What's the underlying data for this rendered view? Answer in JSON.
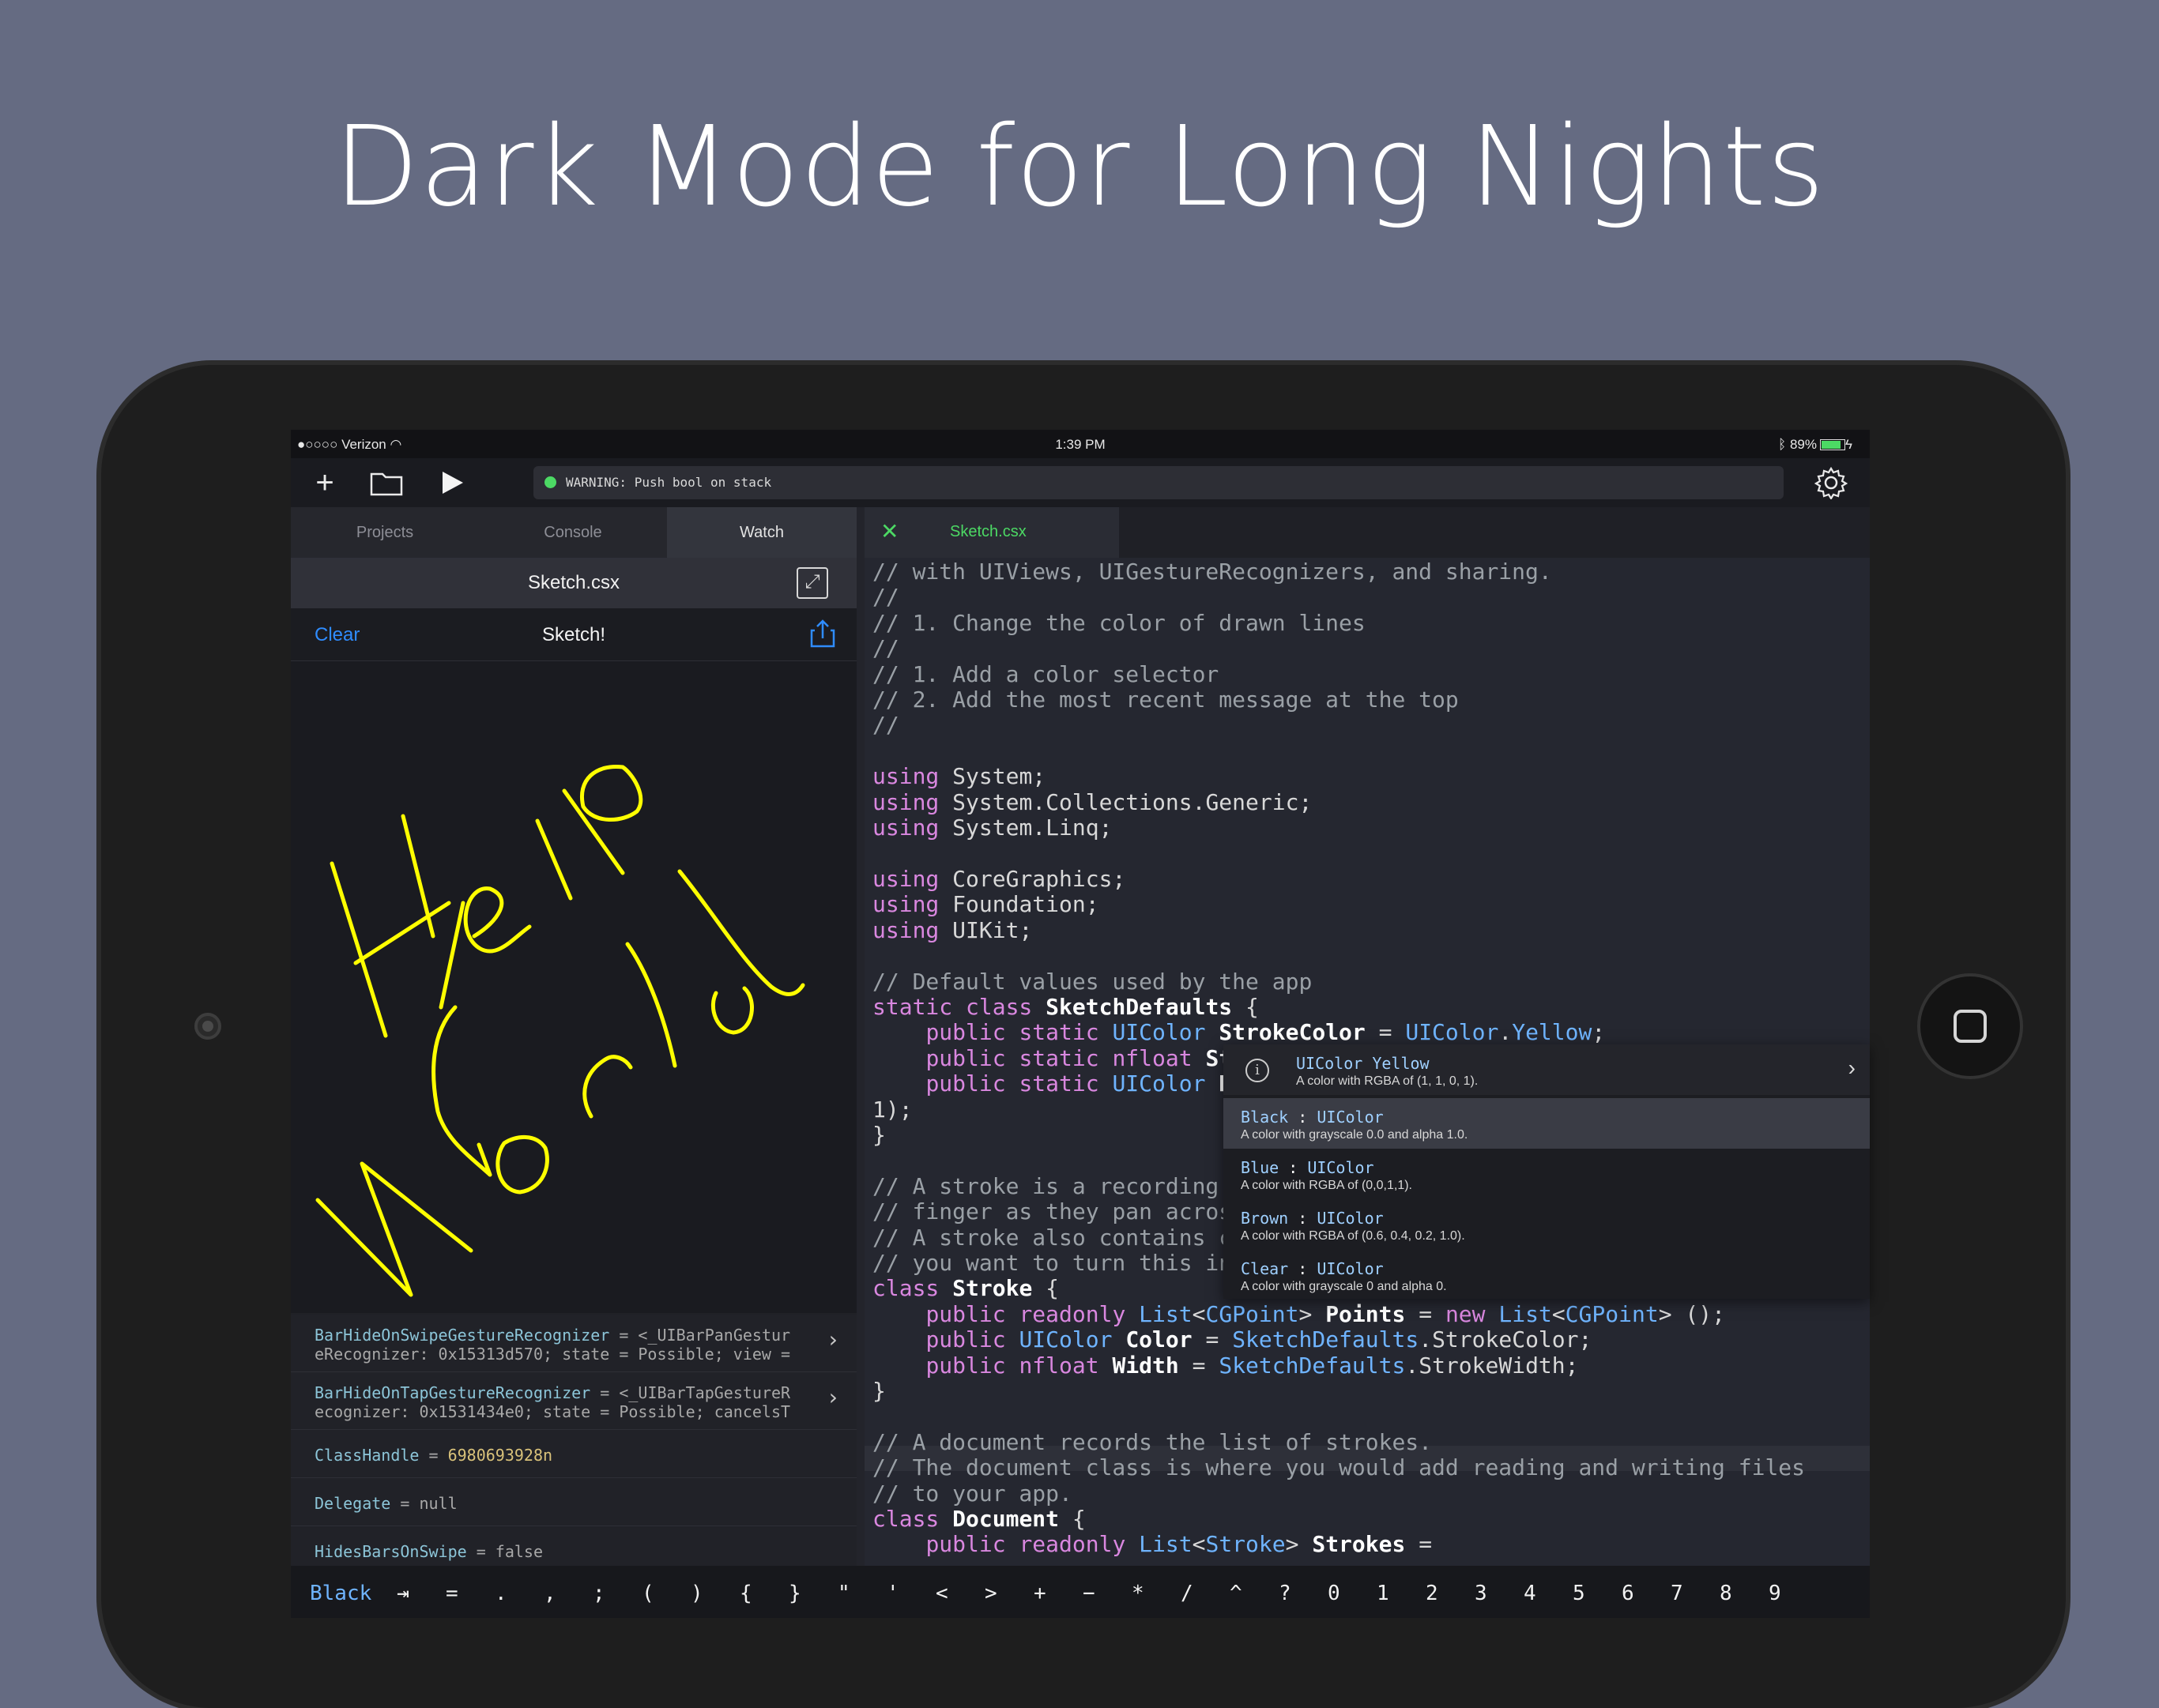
{
  "headline": "Dark Mode for Long Nights",
  "status": {
    "carrier": "●○○○○ Verizon",
    "time": "1:39 PM",
    "battery": "89%"
  },
  "toolbar": {
    "warning": "WARNING: Push bool on stack"
  },
  "left": {
    "tabs": [
      "Projects",
      "Console",
      "Watch"
    ],
    "file_title": "Sketch.csx",
    "clear_label": "Clear",
    "sketch_title": "Sketch!",
    "watch_rows": [
      {
        "name": "BarHideOnSwipeGestureRecognizer",
        "line1": " = <_UIBarPanGestur",
        "line2": "eRecognizer: 0x15313d570; state = Possible; view ="
      },
      {
        "name": "BarHideOnTapGestureRecognizer",
        "line1": " = <_UIBarTapGestureR",
        "line2": "ecognizer: 0x1531434e0; state = Possible; cancelsT"
      },
      {
        "name": "ClassHandle",
        "eq": " = ",
        "value": "6980693928n"
      },
      {
        "name": "Delegate",
        "eq": " = ",
        "value": "null"
      },
      {
        "name": "HidesBarsOnSwipe",
        "eq": " = ",
        "value": "false"
      }
    ]
  },
  "editor": {
    "tab_name": "Sketch.csx"
  },
  "autocomplete": {
    "info_title": "UIColor Yellow",
    "info_desc": "A color with RGBA of (1, 1, 0, 1).",
    "items": [
      {
        "name": "Black",
        "type": "UIColor",
        "desc": "A color with grayscale 0.0 and alpha 1.0."
      },
      {
        "name": "Blue",
        "type": "UIColor",
        "desc": "A color with RGBA of (0,0,1,1)."
      },
      {
        "name": "Brown",
        "type": "UIColor",
        "desc": "A color with RGBA of (0.6, 0.4, 0.2, 1.0)."
      },
      {
        "name": "Clear",
        "type": "UIColor",
        "desc": "A color with grayscale 0 and alpha 0."
      }
    ]
  },
  "keys": [
    "Black",
    "⇥",
    "=",
    ".",
    ",",
    ";",
    "(",
    ")",
    "{",
    "}",
    "\"",
    "'",
    "<",
    ">",
    "+",
    "−",
    "*",
    "/",
    "^",
    "?",
    "0",
    "1",
    "2",
    "3",
    "4",
    "5",
    "6",
    "7",
    "8",
    "9"
  ],
  "colors": {
    "accent_green": "#4cd964",
    "accent_blue": "#2f8cff",
    "stroke": "#ffff00"
  }
}
